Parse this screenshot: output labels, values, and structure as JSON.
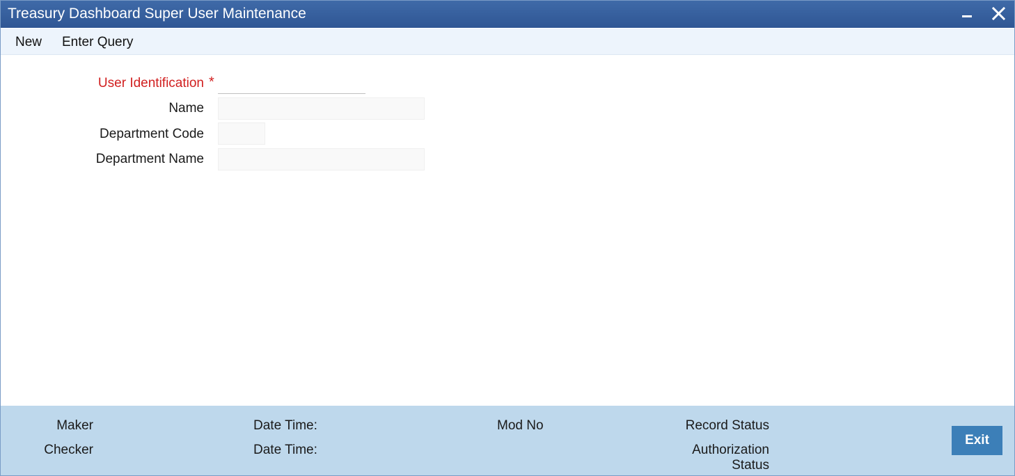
{
  "window": {
    "title": "Treasury Dashboard Super User Maintenance",
    "minimize_icon": "minimize-icon",
    "close_icon": "close-icon"
  },
  "menu": {
    "items": [
      {
        "label": "New"
      },
      {
        "label": "Enter Query"
      }
    ]
  },
  "form": {
    "user_identification": {
      "label": "User Identification",
      "required_marker": "*",
      "value": "",
      "required_color": "#d11f1f"
    },
    "name": {
      "label": "Name",
      "value": ""
    },
    "department_code": {
      "label": "Department Code",
      "value": ""
    },
    "department_name": {
      "label": "Department Name",
      "value": ""
    }
  },
  "footer": {
    "maker_label": "Maker",
    "checker_label": "Checker",
    "maker_datetime_label": "Date Time:",
    "checker_datetime_label": "Date Time:",
    "mod_no_label": "Mod No",
    "record_status_label": "Record Status",
    "authorization_status_label_line1": "Authorization",
    "authorization_status_label_line2": "Status",
    "exit_label": "Exit"
  },
  "colors": {
    "titlebar": "#3f6aa8",
    "menubar": "#edf4fc",
    "footer": "#bed8ec",
    "exit_button": "#3c7fb8"
  }
}
